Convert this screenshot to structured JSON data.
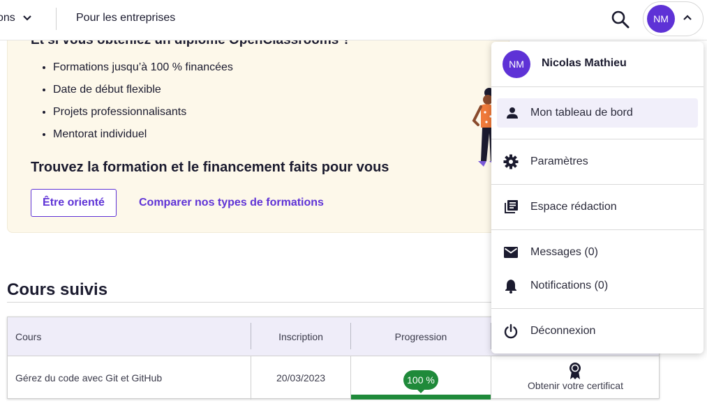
{
  "nav": {
    "cut_label": "ons",
    "business_label": "Pour les entreprises",
    "avatar_initials": "NM",
    "icons": [
      "chevron-down-icon",
      "search-icon",
      "chevron-up-icon"
    ]
  },
  "promo": {
    "heading": "Et si vous obteniez un diplôme OpenClassrooms ?",
    "bullets": [
      "Formations jusqu’à 100 % financées",
      "Date de début flexible",
      "Projets professionnalisants",
      "Mentorat individuel"
    ],
    "subheading": "Trouvez la formation et le financement faits pour vous",
    "btn_orient": "Être orienté",
    "link_compare": "Comparer nos types de formations"
  },
  "courses": {
    "title": "Cours suivis",
    "columns": [
      "Cours",
      "Inscription",
      "Progression"
    ],
    "rows": [
      {
        "course": "Gérez du code avec Git et GitHub",
        "date": "20/03/2023",
        "progress_label": "100 %",
        "progress": 1.0,
        "certificate": "Obtenir votre certificat"
      }
    ]
  },
  "menu": {
    "initials": "NM",
    "user_name": "Nicolas Mathieu",
    "items": [
      {
        "label": "Mon tableau de bord",
        "icon": "person-icon",
        "active": true
      },
      {
        "label": "Paramètres",
        "icon": "gear-icon",
        "active": false
      },
      {
        "label": "Espace rédaction",
        "icon": "library-books-icon",
        "active": false
      },
      {
        "label": "Messages (0)",
        "icon": "mail-icon",
        "active": false
      },
      {
        "label": "Notifications (0)",
        "icon": "bell-icon",
        "active": false
      },
      {
        "label": "Déconnexion",
        "icon": "power-icon",
        "active": false
      }
    ]
  },
  "colors": {
    "accent": "#5e32d6",
    "success": "#1f8a3a",
    "promo_bg": "#fdf8ea",
    "table_head_bg": "#efedf9"
  }
}
